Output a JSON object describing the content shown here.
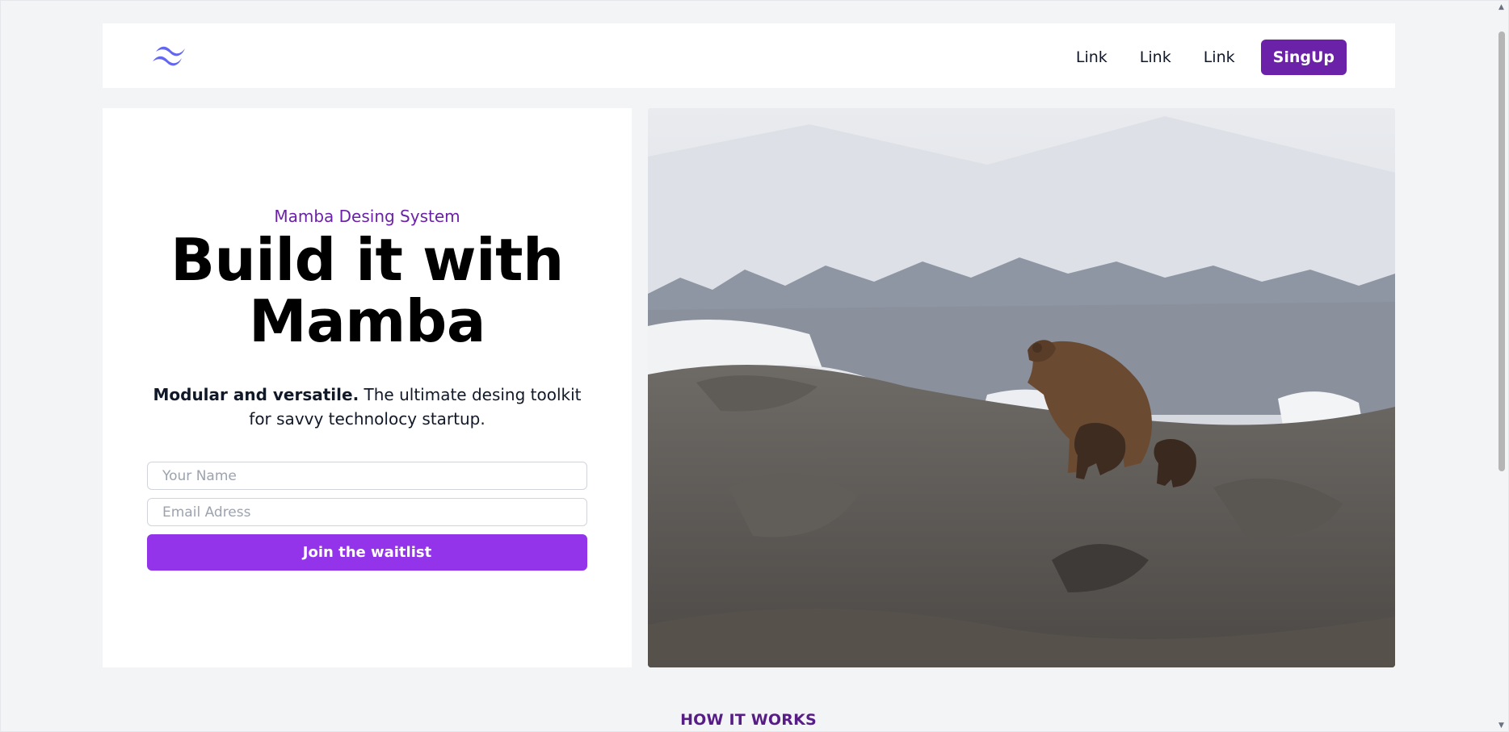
{
  "header": {
    "logo_icon": "wave-logo-icon",
    "nav_links": [
      "Link",
      "Link",
      "Link"
    ],
    "signup_label": "SingUp"
  },
  "hero": {
    "eyebrow": "Mamba Desing System",
    "headline_line1": "Build it with",
    "headline_line2": "Mamba",
    "tagline_bold": "Modular and versatile.",
    "tagline_rest": " The ultimate desing toolkit for savvy technolocy startup.",
    "name_placeholder": "Your Name",
    "email_placeholder": "Email Adress",
    "cta_label": "Join the waitlist"
  },
  "section": {
    "title": "HOW IT WORKS"
  },
  "colors": {
    "brand_dark": "#6b21a8",
    "brand_button": "#9333ea",
    "section_title": "#581c87",
    "logo": "#6366f1"
  }
}
